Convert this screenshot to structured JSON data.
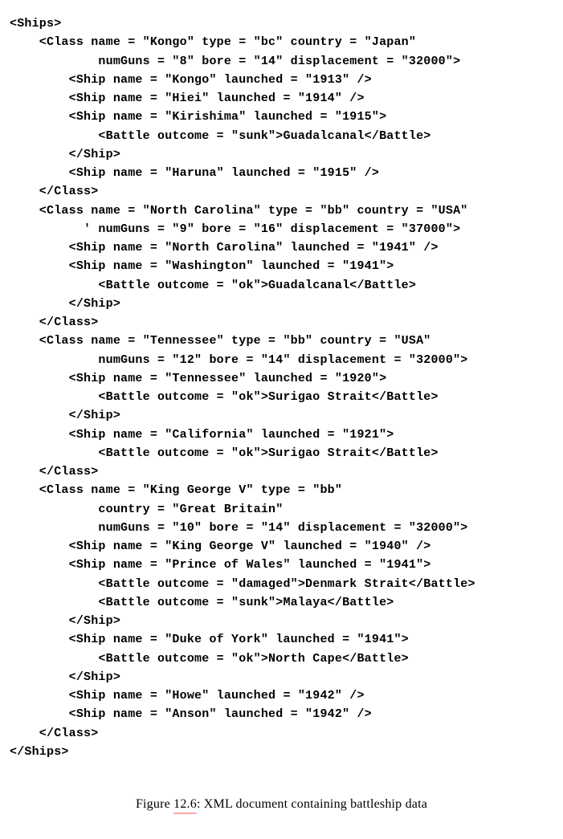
{
  "code": {
    "l01": "<Ships>",
    "l02": "    <Class name = \"Kongo\" type = \"bc\" country = \"Japan\"",
    "l03": "            numGuns = \"8\" bore = \"14\" displacement = \"32000\">",
    "l04": "        <Ship name = \"Kongo\" launched = \"1913\" />",
    "l05": "        <Ship name = \"Hiei\" launched = \"1914\" />",
    "l06": "        <Ship name = \"Kirishima\" launched = \"1915\">",
    "l07": "            <Battle outcome = \"sunk\">Guadalcanal</Battle>",
    "l08": "        </Ship>",
    "l09": "        <Ship name = \"Haruna\" launched = \"1915\" />",
    "l10": "    </Class>",
    "l11": "    <Class name = \"North Carolina\" type = \"bb\" country = \"USA\"",
    "l12": "          ' numGuns = \"9\" bore = \"16\" displacement = \"37000\">",
    "l13": "        <Ship name = \"North Carolina\" launched = \"1941\" />",
    "l14": "        <Ship name = \"Washington\" launched = \"1941\">",
    "l15": "            <Battle outcome = \"ok\">Guadalcanal</Battle>",
    "l16": "        </Ship>",
    "l17": "    </Class>",
    "l18": "    <Class name = \"Tennessee\" type = \"bb\" country = \"USA\"",
    "l19": "            numGuns = \"12\" bore = \"14\" displacement = \"32000\">",
    "l20": "        <Ship name = \"Tennessee\" launched = \"1920\">",
    "l21": "            <Battle outcome = \"ok\">Surigao Strait</Battle>",
    "l22": "        </Ship>",
    "l23": "        <Ship name = \"California\" launched = \"1921\">",
    "l24": "            <Battle outcome = \"ok\">Surigao Strait</Battle>",
    "l25": "    </Class>",
    "l26": "    <Class name = \"King George V\" type = \"bb\"",
    "l27": "            country = \"Great Britain\"",
    "l28": "            numGuns = \"10\" bore = \"14\" displacement = \"32000\">",
    "l29": "        <Ship name = \"King George V\" launched = \"1940\" />",
    "l30": "        <Ship name = \"Prince of Wales\" launched = \"1941\">",
    "l31": "            <Battle outcome = \"damaged\">Denmark Strait</Battle>",
    "l32": "            <Battle outcome = \"sunk\">Malaya</Battle>",
    "l33": "        </Ship>",
    "l34": "        <Ship name = \"Duke of York\" launched = \"1941\">",
    "l35": "            <Battle outcome = \"ok\">North Cape</Battle>",
    "l36": "        </Ship>",
    "l37": "        <Ship name = \"Howe\" launched = \"1942\" />",
    "l38": "        <Ship name = \"Anson\" launched = \"1942\" />",
    "l39": "    </Class>",
    "l40": "</Ships>"
  },
  "caption": {
    "prefix": "Figure ",
    "num": "12.6",
    "text": ": XML document containing battleship data"
  }
}
